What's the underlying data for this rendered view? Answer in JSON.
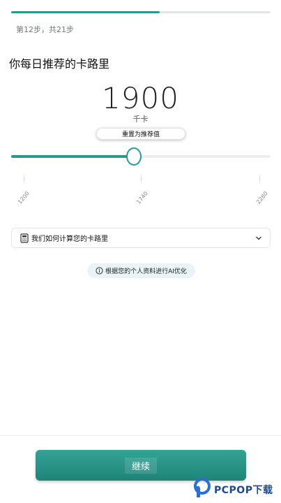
{
  "progress": {
    "step_text": "第12步，共21步",
    "fraction": 0.5714
  },
  "page": {
    "title": "你每日推荐的卡路里"
  },
  "calories": {
    "value": "1900",
    "unit": "千卡",
    "reset_label": "重置为推荐值",
    "min": 1200,
    "max": 2280,
    "current": 1900,
    "ticks": [
      "1200",
      "1740",
      "2280"
    ]
  },
  "info": {
    "accordion_label": "我们如何计算您的卡路里",
    "ai_note": "根据您的个人资料进行AI优化"
  },
  "footer": {
    "continue_label": "继续"
  },
  "watermark": {
    "text": "PCPOP下载"
  },
  "colors": {
    "accent": "#2a9a8e",
    "track": "#eceeee",
    "pill_bg": "#e8f4f6"
  },
  "icons": [
    "calculator-icon",
    "chevron-down-icon",
    "info-icon",
    "pcpop-logo-icon"
  ]
}
